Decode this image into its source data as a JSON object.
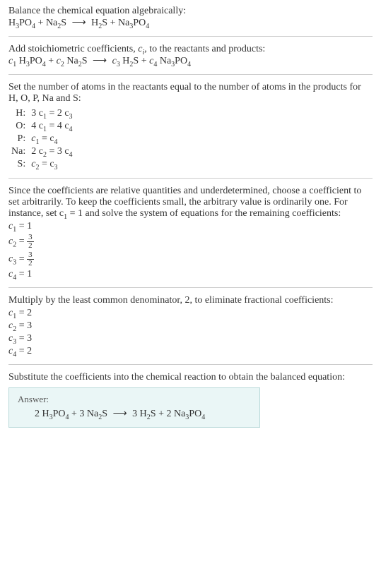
{
  "intro": {
    "line1": "Balance the chemical equation algebraically:"
  },
  "eq1": {
    "r1": "H",
    "r1s1": "3",
    "r1m": "PO",
    "r1s2": "4",
    "plus1": " + ",
    "r2": "Na",
    "r2s1": "2",
    "r2m": "S",
    "arrow": "⟶",
    "p1": "H",
    "p1s1": "2",
    "p1m": "S",
    "plus2": " + ",
    "p2": "Na",
    "p2s1": "3",
    "p2m": "PO",
    "p2s2": "4"
  },
  "stoich": {
    "line1a": "Add stoichiometric coefficients, ",
    "ci_c": "c",
    "ci_i": "i",
    "line1b": ", to the reactants and products:"
  },
  "eq2": {
    "c1": "c",
    "c1s": "1",
    "c2": "c",
    "c2s": "2",
    "c3": "c",
    "c3s": "3",
    "c4": "c",
    "c4s": "4"
  },
  "atoms": {
    "text": "Set the number of atoms in the reactants equal to the number of atoms in the products for H, O, P, Na and S:",
    "rows": [
      {
        "el": "H:",
        "lhs": "3 c",
        "l1": "1",
        "eq": " = 2 c",
        "r1": "3"
      },
      {
        "el": "O:",
        "lhs": "4 c",
        "l1": "1",
        "eq": " = 4 c",
        "r1": "4"
      },
      {
        "el": "P:",
        "lhs": "c",
        "l1": "1",
        "eq": " = c",
        "r1": "4"
      },
      {
        "el": "Na:",
        "lhs": "2 c",
        "l1": "2",
        "eq": " = 3 c",
        "r1": "4"
      },
      {
        "el": "S:",
        "lhs": "c",
        "l1": "2",
        "eq": " = c",
        "r1": "3"
      }
    ]
  },
  "choose": {
    "text": "Since the coefficients are relative quantities and underdetermined, choose a coefficient to set arbitrarily. To keep the coefficients small, the arbitrary value is ordinarily one. For instance, set c",
    "sub1": "1",
    "text2": " = 1 and solve the system of equations for the remaining coefficients:",
    "lines": [
      {
        "c": "c",
        "s": "1",
        "eq": " = 1"
      },
      {
        "c": "c",
        "s": "2",
        "eq": " = ",
        "frac_n": "3",
        "frac_d": "2"
      },
      {
        "c": "c",
        "s": "3",
        "eq": " = ",
        "frac_n": "3",
        "frac_d": "2"
      },
      {
        "c": "c",
        "s": "4",
        "eq": " = 1"
      }
    ]
  },
  "lcd": {
    "text": "Multiply by the least common denominator, 2, to eliminate fractional coefficients:",
    "lines": [
      {
        "c": "c",
        "s": "1",
        "eq": " = 2"
      },
      {
        "c": "c",
        "s": "2",
        "eq": " = 3"
      },
      {
        "c": "c",
        "s": "3",
        "eq": " = 3"
      },
      {
        "c": "c",
        "s": "4",
        "eq": " = 2"
      }
    ]
  },
  "final": {
    "text": "Substitute the coefficients into the chemical reaction to obtain the balanced equation:",
    "answer_label": "Answer:",
    "eq": {
      "a": "2 H",
      "as1": "3",
      "am": "PO",
      "as2": "4",
      "plus1": " + 3 Na",
      "bs1": "2",
      "bm": "S",
      "arrow": "⟶",
      "c": "3 H",
      "cs1": "2",
      "cm": "S",
      "plus2": " + 2 Na",
      "ds1": "3",
      "dm": "PO",
      "ds2": "4"
    }
  }
}
